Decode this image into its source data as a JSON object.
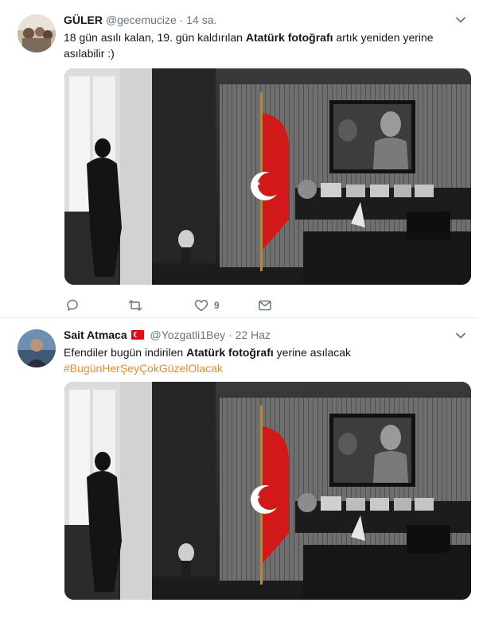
{
  "tweets": [
    {
      "name": "GÜLER",
      "handle": "@gecemucize",
      "dot": "·",
      "time": "14 sa.",
      "text_before": "18 gün asılı kalan, 19. gün kaldırılan ",
      "text_bold": "Atatürk fotoğrafı",
      "text_after": " artık yeniden yerine asılabilir :)",
      "actions": {
        "reply_count": "",
        "retweet_count": "",
        "like_count": "9",
        "dm_label": ""
      }
    },
    {
      "name": "Sait Atmaca",
      "handle": "@Yozgatli1Bey",
      "dot": "·",
      "time": "22 Haz",
      "text_before": "Efendiler bugün indirilen ",
      "text_bold": "Atatürk fotoğrafı",
      "text_after": " yerine asılacak",
      "hashtag": "#BugünHerŞeyÇokGüzelOlacak"
    }
  ],
  "colors": {
    "link_hashtag": "#f08a24",
    "text_primary": "#14171a",
    "text_secondary": "#657786",
    "divider": "#e6ecf0",
    "flag_red": "#e30a17"
  },
  "icons": [
    "chevron-down-icon",
    "reply-icon",
    "retweet-icon",
    "like-icon",
    "dm-icon",
    "turkish-flag-icon"
  ]
}
